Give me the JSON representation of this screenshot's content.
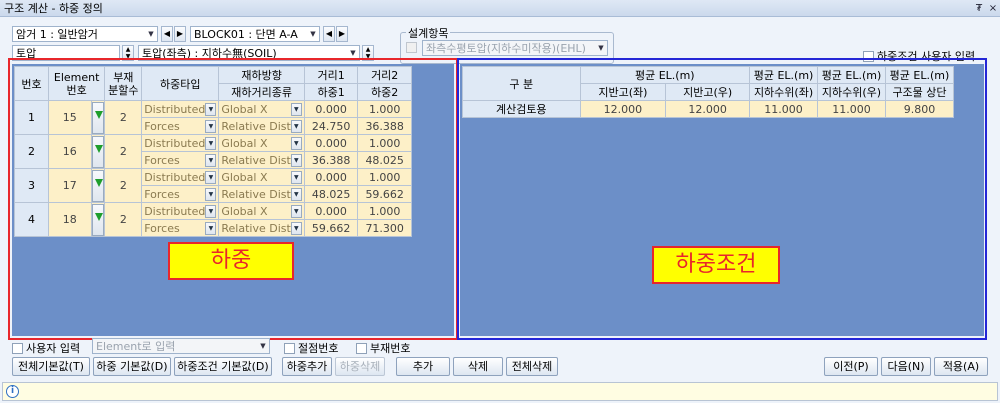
{
  "window": {
    "title": "구조 계산 - 하중 정의",
    "pin_glyph": "₮",
    "close_glyph": "×"
  },
  "top": {
    "combo_left1": "암거 1 : 일반암거",
    "combo_left2": "토압",
    "combo_block": "BLOCK01 : 단면 A-A",
    "combo_soil": "토압(좌측) : 지하수無(SOIL)",
    "design_group_label": "설계항목",
    "design_combo": "좌측수평토압(지하수미작용)(EHL)",
    "load_condition_user_input": "하중조건 사용자 입력"
  },
  "left_grid": {
    "headers": {
      "no": "번호",
      "element": "Element\n번호",
      "split": "부재\n분할수",
      "load_type": "하중타입",
      "dir": "재하방향",
      "dist_type": "재하거리종류",
      "dist1": "거리1",
      "dist2": "거리2",
      "load1": "하중1",
      "load2": "하중2"
    },
    "rows": [
      {
        "no": "1",
        "element": "15",
        "split": "2",
        "sub": [
          {
            "type": "Distributed",
            "dir": "Global X",
            "d1": "0.000",
            "d2": "1.000"
          },
          {
            "type": "Forces",
            "dir": "Relative Dist",
            "d1": "24.750",
            "d2": "36.388"
          }
        ]
      },
      {
        "no": "2",
        "element": "16",
        "split": "2",
        "sub": [
          {
            "type": "Distributed",
            "dir": "Global X",
            "d1": "0.000",
            "d2": "1.000"
          },
          {
            "type": "Forces",
            "dir": "Relative Dist",
            "d1": "36.388",
            "d2": "48.025"
          }
        ]
      },
      {
        "no": "3",
        "element": "17",
        "split": "2",
        "sub": [
          {
            "type": "Distributed",
            "dir": "Global X",
            "d1": "0.000",
            "d2": "1.000"
          },
          {
            "type": "Forces",
            "dir": "Relative Dist",
            "d1": "48.025",
            "d2": "59.662"
          }
        ]
      },
      {
        "no": "4",
        "element": "18",
        "split": "2",
        "sub": [
          {
            "type": "Distributed",
            "dir": "Global X",
            "d1": "0.000",
            "d2": "1.000"
          },
          {
            "type": "Forces",
            "dir": "Relative Dist",
            "d1": "59.662",
            "d2": "71.300"
          }
        ]
      }
    ],
    "overlay_label": "하중"
  },
  "right_grid": {
    "headers": {
      "gubun": "구 분",
      "avg1": "평균 EL.(m)",
      "avg2": "평균 EL.(m)",
      "avg3": "평균 EL.(m)",
      "avg4": "평균 EL.(m)",
      "sub1": "지반고(좌)",
      "sub2": "지반고(우)",
      "sub3": "지하수위(좌)",
      "sub4": "지하수위(우)",
      "sub5": "구조물 상단"
    },
    "row": {
      "label": "계산검토용",
      "v1": "12.000",
      "v2": "12.000",
      "v3": "11.000",
      "v4": "11.000",
      "v5": "9.800"
    },
    "overlay_label": "하중조건"
  },
  "bottom": {
    "user_input": "사용자 입력",
    "element_combo": "Element로 입력",
    "node_no": "절점번호",
    "member_no": "부재번호",
    "buttons": {
      "all_default": "전체기본값(T)",
      "load_default": "하중 기본값(D)",
      "cond_default": "하중조건 기본값(D)",
      "add_load": "하중추가",
      "del_load": "하중삭제",
      "add": "추가",
      "delete": "삭제",
      "delete_all": "전체삭제",
      "prev": "이전(P)",
      "next": "다음(N)",
      "apply": "적용(A)"
    }
  },
  "status": {
    "icon": "i"
  }
}
